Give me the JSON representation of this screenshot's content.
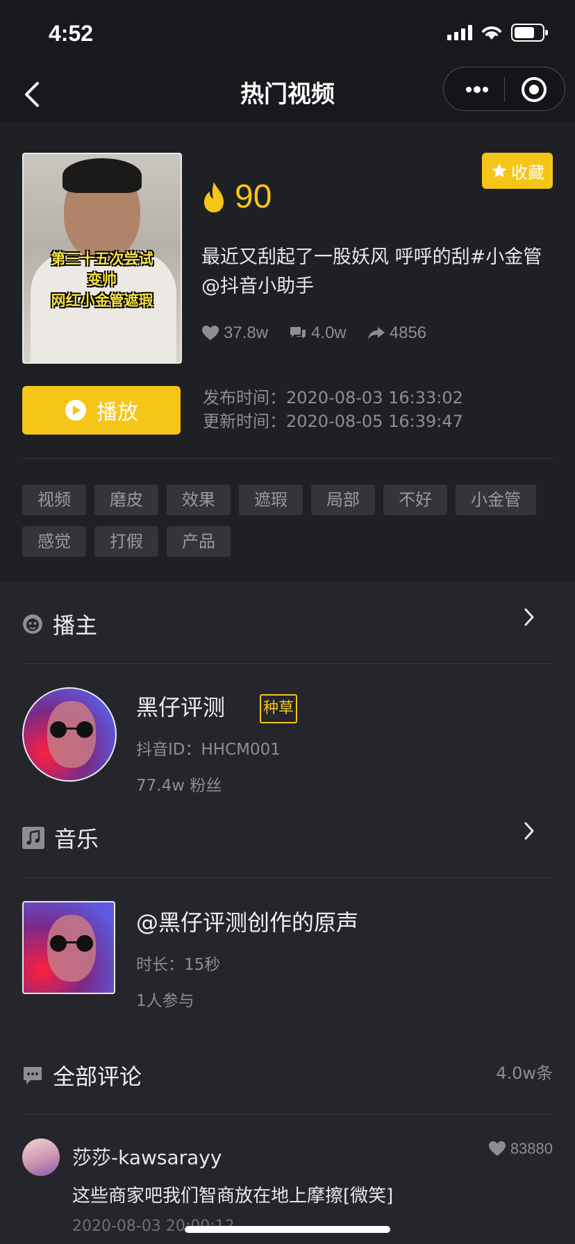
{
  "status_bar": {
    "time": "4:52"
  },
  "nav": {
    "title": "热门视频"
  },
  "video": {
    "thumb_caption_line1": "第三十五次尝试",
    "thumb_caption_line2": "变帅",
    "thumb_caption_line3": "网红小金管遮瑕",
    "favorite_label": "收藏",
    "heat": "90",
    "description": "最近又刮起了一股妖风 呼呼的刮#小金管 @抖音小助手",
    "likes": "37.8w",
    "comments": "4.0w",
    "shares": "4856",
    "play_label": "播放",
    "publish_time": "发布时间：2020-08-03 16:33:02",
    "update_time": "更新时间：2020-08-05 16:39:47",
    "tags": [
      "视频",
      "磨皮",
      "效果",
      "遮瑕",
      "局部",
      "不好",
      "小金管",
      "感觉",
      "打假",
      "产品"
    ]
  },
  "host": {
    "section_title": "播主",
    "name": "黑仔评测",
    "badge": "种草",
    "douyin_id": "抖音ID：HHCM001",
    "fans": "77.4w 粉丝"
  },
  "music": {
    "section_title": "音乐",
    "title": "@黑仔评测创作的原声",
    "duration": "时长：15秒",
    "participants": "1人参与"
  },
  "comments_section": {
    "title": "全部评论",
    "count": "4.0w条",
    "items": [
      {
        "user": "莎莎-kawsarayy",
        "likes": "83880",
        "text": "这些商家吧我们智商放在地上摩擦[微笑]",
        "date": "2020-08-03 20:00:12"
      }
    ]
  },
  "colors": {
    "accent": "#f5c518",
    "background": "#1b1c20",
    "muted_text": "#8d8e93"
  },
  "icons": [
    "back-icon",
    "more-icon",
    "target-icon",
    "star-icon",
    "fire-icon",
    "heart-icon",
    "comment-icon",
    "share-icon",
    "play-icon",
    "monkey-icon",
    "music-note-icon",
    "chevron-right-icon",
    "comment-bubble-icon"
  ]
}
